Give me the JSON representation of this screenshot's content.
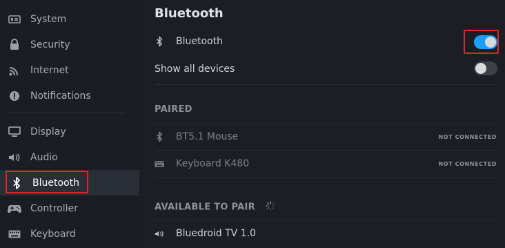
{
  "sidebar": {
    "items": [
      {
        "label": "System",
        "icon": "system-icon"
      },
      {
        "label": "Security",
        "icon": "lock-icon"
      },
      {
        "label": "Internet",
        "icon": "wifi-icon"
      },
      {
        "label": "Notifications",
        "icon": "bell-icon"
      },
      {
        "label": "Display",
        "icon": "monitor-icon"
      },
      {
        "label": "Audio",
        "icon": "speaker-icon"
      },
      {
        "label": "Bluetooth",
        "icon": "bluetooth-icon",
        "active": true
      },
      {
        "label": "Controller",
        "icon": "gamepad-icon"
      },
      {
        "label": "Keyboard",
        "icon": "keyboard-icon"
      }
    ]
  },
  "main": {
    "title": "Bluetooth",
    "bluetooth_toggle": {
      "label": "Bluetooth",
      "on": true
    },
    "show_all_devices": {
      "label": "Show all devices",
      "on": false
    },
    "paired": {
      "heading": "PAIRED",
      "devices": [
        {
          "name": "BT5.1 Mouse",
          "status": "NOT CONNECTED",
          "icon": "bluetooth-icon"
        },
        {
          "name": "Keyboard K480",
          "status": "NOT CONNECTED",
          "icon": "keyboard-icon"
        }
      ]
    },
    "available": {
      "heading": "AVAILABLE TO PAIR",
      "devices": [
        {
          "name": "Bluedroid TV 1.0",
          "icon": "speaker-icon"
        }
      ]
    }
  },
  "colors": {
    "accent": "#1a9fff",
    "highlight": "#e02424",
    "background": "#1b1e25"
  }
}
